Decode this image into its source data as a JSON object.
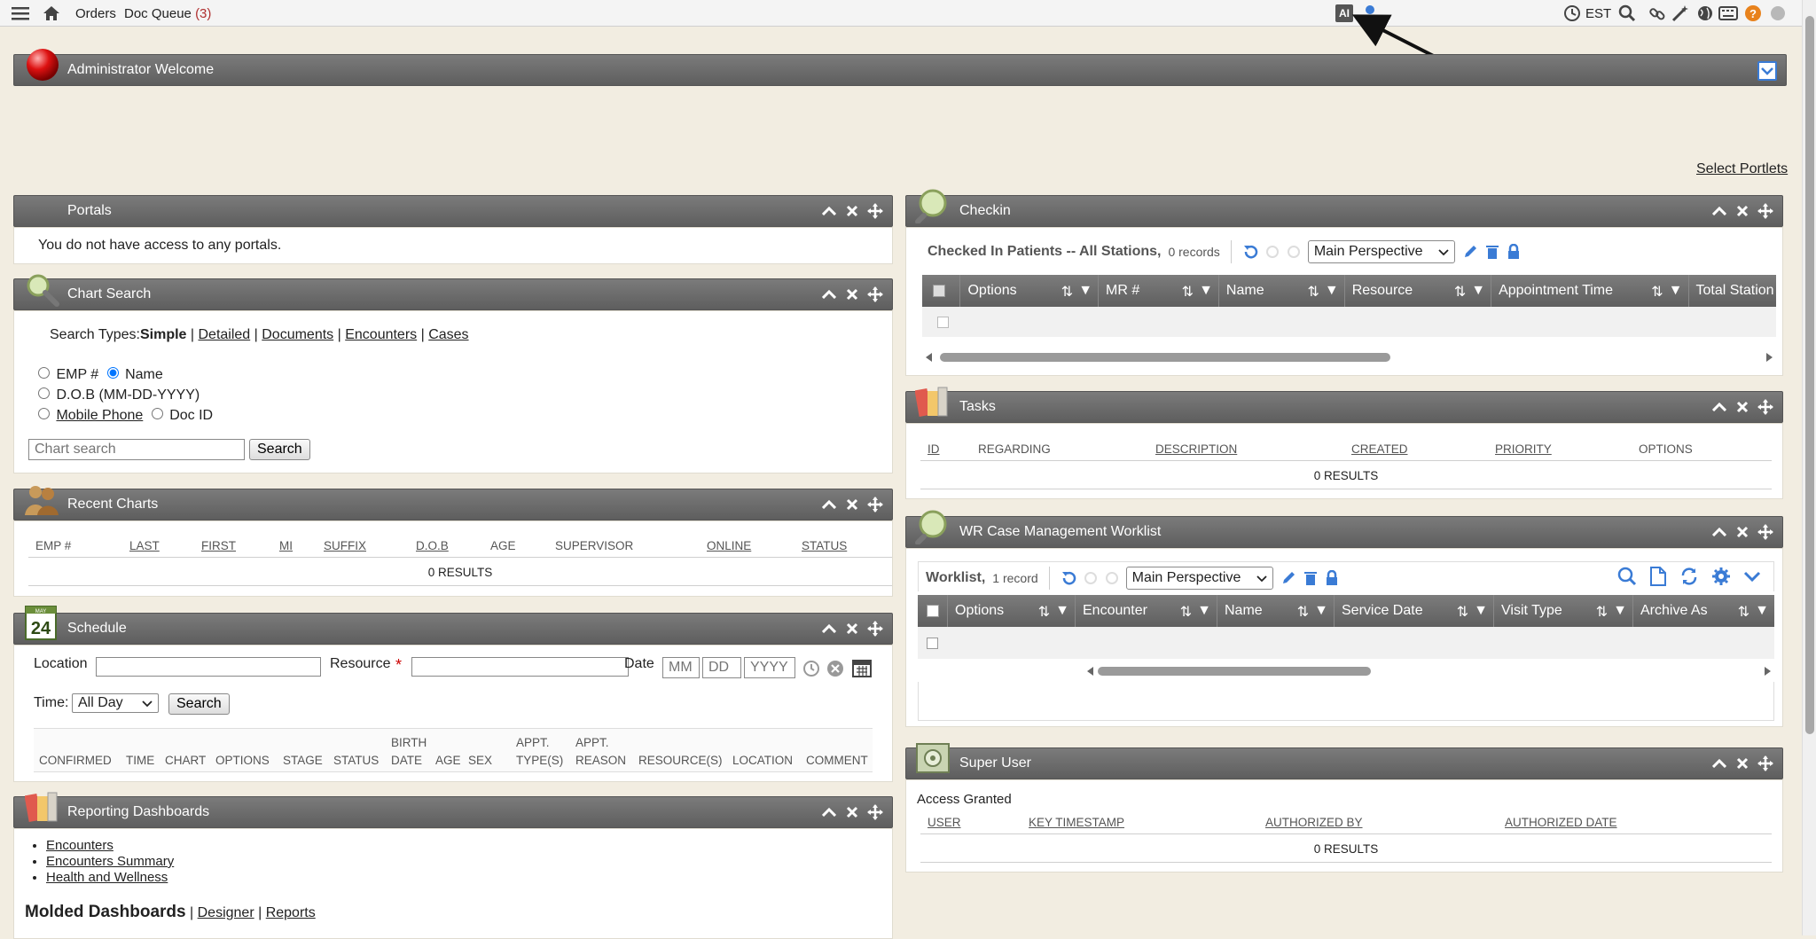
{
  "topbar": {
    "orders": "Orders",
    "doc_queue": "Doc Queue",
    "doc_queue_count": "(3)",
    "ai_badge": "AI",
    "timezone": "EST"
  },
  "welcome": {
    "title": "Administrator Welcome",
    "select_portlets": "Select Portlets"
  },
  "portals": {
    "title": "Portals",
    "message": "You do not have access to any portals."
  },
  "chart_search": {
    "title": "Chart Search",
    "search_types_label": "Search Types:",
    "types": [
      "Simple",
      "Detailed",
      "Documents",
      "Encounters",
      "Cases"
    ],
    "options": {
      "emp": "EMP #",
      "name": "Name",
      "dob": "D.O.B (MM-DD-YYYY)",
      "mobile": "Mobile Phone",
      "docid": "Doc ID"
    },
    "placeholder": "Chart search",
    "button": "Search"
  },
  "recent_charts": {
    "title": "Recent Charts",
    "columns": [
      "EMP #",
      "LAST",
      "FIRST",
      "MI",
      "SUFFIX",
      "D.O.B",
      "AGE",
      "SUPERVISOR",
      "ONLINE",
      "STATUS"
    ],
    "results": "0 RESULTS"
  },
  "schedule": {
    "title": "Schedule",
    "calendar_label": "MAY",
    "calendar_day": "24",
    "location": "Location",
    "resource": "Resource",
    "required": "*",
    "date": "Date",
    "mm": "MM",
    "dd": "DD",
    "yyyy": "YYYY",
    "time_label": "Time:",
    "time_value": "All Day",
    "search": "Search",
    "columns": [
      {
        "l1": "",
        "l2": "CONFIRMED"
      },
      {
        "l1": "",
        "l2": "TIME"
      },
      {
        "l1": "",
        "l2": "CHART"
      },
      {
        "l1": "",
        "l2": "OPTIONS"
      },
      {
        "l1": "",
        "l2": "STAGE"
      },
      {
        "l1": "",
        "l2": "STATUS"
      },
      {
        "l1": "BIRTH",
        "l2": "DATE"
      },
      {
        "l1": "",
        "l2": "AGE"
      },
      {
        "l1": "",
        "l2": "SEX"
      },
      {
        "l1": "APPT.",
        "l2": "TYPE(S)"
      },
      {
        "l1": "APPT.",
        "l2": "REASON"
      },
      {
        "l1": "",
        "l2": "RESOURCE(S)"
      },
      {
        "l1": "",
        "l2": "LOCATION"
      },
      {
        "l1": "",
        "l2": "COMMENT"
      }
    ]
  },
  "reporting": {
    "title": "Reporting Dashboards",
    "links": [
      "Encounters",
      "Encounters Summary",
      "Health and Wellness"
    ],
    "molded": "Molded Dashboards",
    "designer": "Designer",
    "reports": "Reports"
  },
  "checkin": {
    "title": "Checkin",
    "caption": "Checked In Patients -- All Stations,",
    "records": "0 records",
    "perspective": "Main Perspective",
    "columns": [
      "Options",
      "MR #",
      "Name",
      "Resource",
      "Appointment Time",
      "Total Station"
    ]
  },
  "tasks": {
    "title": "Tasks",
    "columns": [
      "ID",
      "REGARDING",
      "DESCRIPTION",
      "CREATED",
      "PRIORITY",
      "OPTIONS"
    ],
    "results": "0 RESULTS"
  },
  "worklist": {
    "title": "WR Case Management Worklist",
    "caption": "Worklist,",
    "records": "1 record",
    "perspective": "Main Perspective",
    "columns": [
      "Options",
      "Encounter",
      "Name",
      "Service Date",
      "Visit Type",
      "Archive As"
    ]
  },
  "super_user": {
    "title": "Super User",
    "access": "Access Granted",
    "columns": [
      "USER",
      "KEY TIMESTAMP",
      "AUTHORIZED BY",
      "AUTHORIZED DATE"
    ],
    "results": "0 RESULTS"
  }
}
